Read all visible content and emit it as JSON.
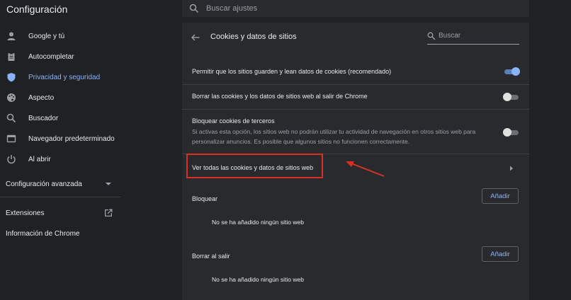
{
  "app": {
    "title": "Configuración"
  },
  "search": {
    "placeholder": "Buscar ajustes"
  },
  "sidebar": {
    "items": [
      {
        "label": "Google y tú",
        "icon": "person-icon"
      },
      {
        "label": "Autocompletar",
        "icon": "clipboard-icon"
      },
      {
        "label": "Privacidad y seguridad",
        "icon": "shield-icon",
        "active": true
      },
      {
        "label": "Aspecto",
        "icon": "palette-icon"
      },
      {
        "label": "Buscador",
        "icon": "search-icon"
      },
      {
        "label": "Navegador predeterminado",
        "icon": "browser-icon"
      },
      {
        "label": "Al abrir",
        "icon": "power-icon"
      }
    ],
    "advanced_label": "Configuración avanzada",
    "extensions_label": "Extensiones",
    "about_label": "Información de Chrome"
  },
  "panel": {
    "title": "Cookies y datos de sitios",
    "search_placeholder": "Buscar",
    "rows": {
      "allow_cookies": {
        "label": "Permitir que los sitios guarden y lean datos de cookies (recomendado)",
        "enabled": true
      },
      "clear_on_exit": {
        "label": "Borrar las cookies y los datos de sitios web al salir de Chrome",
        "enabled": false
      },
      "block_third_party": {
        "label": "Bloquear cookies de terceros",
        "description": "Si activas esta opción, los sitios web no podrán utilizar tu actividad de navegación en otros sitios web para personalizar anuncios. Es posible que algunos sitios no funcionen correctamente.",
        "enabled": false
      },
      "see_all": {
        "label": "Ver todas las cookies y datos de sitios web"
      }
    },
    "block_section": {
      "label": "Bloquear",
      "button": "Añadir",
      "empty": "No se ha añadido ningún sitio web"
    },
    "clear_section": {
      "label": "Borrar al salir",
      "button": "Añadir",
      "empty": "No se ha añadido ningún sitio web"
    }
  },
  "colors": {
    "background": "#202124",
    "panel": "#292a2d",
    "accent": "#8ab4f8",
    "highlight": "#d93025"
  }
}
